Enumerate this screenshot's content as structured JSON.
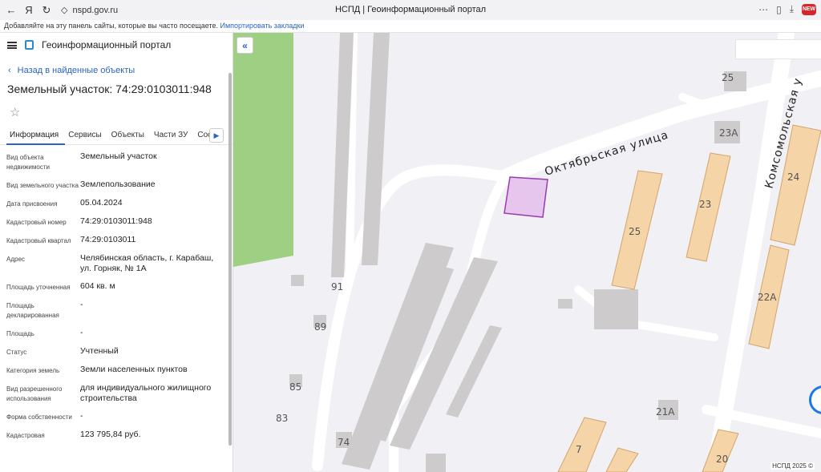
{
  "browser": {
    "back_icon": "arrow-left-icon",
    "url": "nspd.gov.ru",
    "tab_title": "НСПД | Геоинформационный портал",
    "bookmarks_hint": "Добавляйте на эту панель сайты, которые вы часто посещаете.",
    "bookmarks_link": "Импортировать закладки",
    "extension_badge": "NEW"
  },
  "app": {
    "title": "Геоинформационный портал",
    "back_label": "Назад в найденные объекты",
    "object_title": "Земельный участок: 74:29:0103011:948",
    "tabs": [
      "Информация",
      "Сервисы",
      "Объекты",
      "Части ЗУ",
      "Соста"
    ],
    "properties": [
      {
        "label": "Вид объекта недвижимости",
        "value": "Земельный участок"
      },
      {
        "label": "Вид земельного участка",
        "value": "Землепользование"
      },
      {
        "label": "Дата присвоения",
        "value": "05.04.2024"
      },
      {
        "label": "Кадастровый номер",
        "value": "74:29:0103011:948"
      },
      {
        "label": "Кадастровый квартал",
        "value": "74:29:0103011"
      },
      {
        "label": "Адрес",
        "value": "Челябинская область, г. Карабаш, ул. Горняк, № 1А"
      },
      {
        "label": "Площадь уточненная",
        "value": "604 кв. м"
      },
      {
        "label": "Площадь декларированная",
        "value": "-"
      },
      {
        "label": "Площадь",
        "value": "-"
      },
      {
        "label": "Статус",
        "value": "Учтенный"
      },
      {
        "label": "Категория земель",
        "value": "Земли населенных пунктов"
      },
      {
        "label": "Вид разрешенного использования",
        "value": "для индивидуального жилищного строительства"
      },
      {
        "label": "Форма собственности",
        "value": "-"
      },
      {
        "label": "Кадастровая",
        "value": "123 795,84 руб."
      }
    ]
  },
  "map": {
    "streets": [
      "Октябрьская улица",
      "Комсомольская у"
    ],
    "house_numbers": [
      "25",
      "23А",
      "24",
      "23",
      "25",
      "22А",
      "91",
      "89",
      "85",
      "83",
      "74",
      "21А",
      "7",
      "20"
    ],
    "copyright": "НСПД 2025 ©",
    "colors": {
      "parcel": "#e6c6ec",
      "parcel_border": "#9a3bb0",
      "building": "#f5d4a8",
      "green": "#9fcf82"
    }
  }
}
